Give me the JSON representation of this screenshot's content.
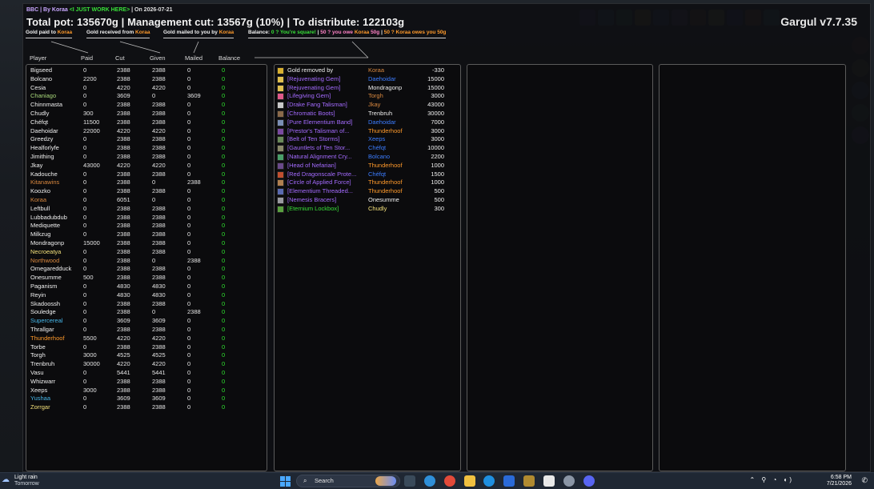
{
  "header": {
    "meta_prefix": "BBC | By Koraa ",
    "meta_note": "<I JUST WORK HERE>",
    "meta_date": " | On 2026-07-21",
    "title": "Total pot: 135670g | Management cut: 13567g (10%) | To distribute: 122103g",
    "brand": "Gargul v7.7.35"
  },
  "legend": {
    "paid_label": "Gold paid to ",
    "paid_name": "Koraa",
    "received_label": "Gold received from ",
    "received_name": "Koraa",
    "mailed_label": "Gold mailed to you by ",
    "mailed_name": "Koraa",
    "balance_label": "Balance: ",
    "balance_square": "0 ? You're square!",
    "sep1": " | ",
    "balance_owe_prefix": "50 ? you owe ",
    "balance_owe_name": "Koraa",
    "balance_owe_amount": " 50g",
    "sep2": " | ",
    "balance_owed_prefix": "50 ? ",
    "balance_owed_name": "Koraa",
    "balance_owed_suffix": " owes you 50g"
  },
  "columns": {
    "player": "Player",
    "paid": "Paid",
    "cut": "Cut",
    "given": "Given",
    "mailed": "Mailed",
    "balance": "Balance"
  },
  "players": [
    {
      "name": "Bigseed",
      "paid": "0",
      "cut": "2388",
      "given": "2388",
      "mailed": "0",
      "balance": "0",
      "color": "#f0f0f0"
    },
    {
      "name": "Bolcano",
      "paid": "2200",
      "cut": "2388",
      "given": "2388",
      "mailed": "0",
      "balance": "0",
      "color": "#f0f0f0"
    },
    {
      "name": "Cesia",
      "paid": "0",
      "cut": "4220",
      "given": "4220",
      "mailed": "0",
      "balance": "0",
      "color": "#f0f0f0"
    },
    {
      "name": "Chaniago",
      "paid": "0",
      "cut": "3609",
      "given": "0",
      "mailed": "3609",
      "balance": "0",
      "color": "#a8d87a"
    },
    {
      "name": "Chinnmasta",
      "paid": "0",
      "cut": "2388",
      "given": "2388",
      "mailed": "0",
      "balance": "0",
      "color": "#f0f0f0"
    },
    {
      "name": "Chudly",
      "paid": "300",
      "cut": "2388",
      "given": "2388",
      "mailed": "0",
      "balance": "0",
      "color": "#f0f0f0"
    },
    {
      "name": "Chéfqt",
      "paid": "11500",
      "cut": "2388",
      "given": "2388",
      "mailed": "0",
      "balance": "0",
      "color": "#f0f0f0"
    },
    {
      "name": "Daehoidar",
      "paid": "22000",
      "cut": "4220",
      "given": "4220",
      "mailed": "0",
      "balance": "0",
      "color": "#f0f0f0"
    },
    {
      "name": "Greedzy",
      "paid": "0",
      "cut": "2388",
      "given": "2388",
      "mailed": "0",
      "balance": "0",
      "color": "#f0f0f0"
    },
    {
      "name": "Healforlyfe",
      "paid": "0",
      "cut": "2388",
      "given": "2388",
      "mailed": "0",
      "balance": "0",
      "color": "#f0f0f0"
    },
    {
      "name": "Jimithing",
      "paid": "0",
      "cut": "2388",
      "given": "2388",
      "mailed": "0",
      "balance": "0",
      "color": "#f0f0f0"
    },
    {
      "name": "Jkay",
      "paid": "43000",
      "cut": "4220",
      "given": "4220",
      "mailed": "0",
      "balance": "0",
      "color": "#f0f0f0"
    },
    {
      "name": "Kadouche",
      "paid": "0",
      "cut": "2388",
      "given": "2388",
      "mailed": "0",
      "balance": "0",
      "color": "#f0f0f0"
    },
    {
      "name": "Kitanawins",
      "paid": "0",
      "cut": "2388",
      "given": "0",
      "mailed": "2388",
      "balance": "0",
      "color": "#d9883f"
    },
    {
      "name": "Koozko",
      "paid": "0",
      "cut": "2388",
      "given": "2388",
      "mailed": "0",
      "balance": "0",
      "color": "#f0f0f0"
    },
    {
      "name": "Koraa",
      "paid": "0",
      "cut": "6051",
      "given": "0",
      "mailed": "0",
      "balance": "0",
      "color": "#d9883f"
    },
    {
      "name": "Leftbull",
      "paid": "0",
      "cut": "2388",
      "given": "2388",
      "mailed": "0",
      "balance": "0",
      "color": "#f0f0f0"
    },
    {
      "name": "Lubbadubdub",
      "paid": "0",
      "cut": "2388",
      "given": "2388",
      "mailed": "0",
      "balance": "0",
      "color": "#f0f0f0"
    },
    {
      "name": "Mediquette",
      "paid": "0",
      "cut": "2388",
      "given": "2388",
      "mailed": "0",
      "balance": "0",
      "color": "#f0f0f0"
    },
    {
      "name": "Milkzug",
      "paid": "0",
      "cut": "2388",
      "given": "2388",
      "mailed": "0",
      "balance": "0",
      "color": "#f0f0f0"
    },
    {
      "name": "Mondragonp",
      "paid": "15000",
      "cut": "2388",
      "given": "2388",
      "mailed": "0",
      "balance": "0",
      "color": "#f0f0f0"
    },
    {
      "name": "Necroeatya",
      "paid": "0",
      "cut": "2388",
      "given": "2388",
      "mailed": "0",
      "balance": "0",
      "color": "#f3e07a"
    },
    {
      "name": "Northwood",
      "paid": "0",
      "cut": "2388",
      "given": "0",
      "mailed": "2388",
      "balance": "0",
      "color": "#d9883f"
    },
    {
      "name": "Omegaredduck",
      "paid": "0",
      "cut": "2388",
      "given": "2388",
      "mailed": "0",
      "balance": "0",
      "color": "#f0f0f0"
    },
    {
      "name": "Onesumme",
      "paid": "500",
      "cut": "2388",
      "given": "2388",
      "mailed": "0",
      "balance": "0",
      "color": "#f0f0f0"
    },
    {
      "name": "Paganism",
      "paid": "0",
      "cut": "4830",
      "given": "4830",
      "mailed": "0",
      "balance": "0",
      "color": "#f0f0f0"
    },
    {
      "name": "Reyin",
      "paid": "0",
      "cut": "4830",
      "given": "4830",
      "mailed": "0",
      "balance": "0",
      "color": "#f0f0f0"
    },
    {
      "name": "Skadoossh",
      "paid": "0",
      "cut": "2388",
      "given": "2388",
      "mailed": "0",
      "balance": "0",
      "color": "#f0f0f0"
    },
    {
      "name": "Souledge",
      "paid": "0",
      "cut": "2388",
      "given": "0",
      "mailed": "2388",
      "balance": "0",
      "color": "#f0f0f0"
    },
    {
      "name": "Supercereal",
      "paid": "0",
      "cut": "3609",
      "given": "3609",
      "mailed": "0",
      "balance": "0",
      "color": "#46b6e8"
    },
    {
      "name": "Thrallgar",
      "paid": "0",
      "cut": "2388",
      "given": "2388",
      "mailed": "0",
      "balance": "0",
      "color": "#f0f0f0"
    },
    {
      "name": "Thunderhoof",
      "paid": "5500",
      "cut": "4220",
      "given": "4220",
      "mailed": "0",
      "balance": "0",
      "color": "#ff9a2b"
    },
    {
      "name": "Torbe",
      "paid": "0",
      "cut": "2388",
      "given": "2388",
      "mailed": "0",
      "balance": "0",
      "color": "#f0f0f0"
    },
    {
      "name": "Torgh",
      "paid": "3000",
      "cut": "4525",
      "given": "4525",
      "mailed": "0",
      "balance": "0",
      "color": "#f0f0f0"
    },
    {
      "name": "Trenbruh",
      "paid": "30000",
      "cut": "4220",
      "given": "4220",
      "mailed": "0",
      "balance": "0",
      "color": "#f0f0f0"
    },
    {
      "name": "Vasu",
      "paid": "0",
      "cut": "5441",
      "given": "5441",
      "mailed": "0",
      "balance": "0",
      "color": "#f0f0f0"
    },
    {
      "name": "Whizwarr",
      "paid": "0",
      "cut": "2388",
      "given": "2388",
      "mailed": "0",
      "balance": "0",
      "color": "#f0f0f0"
    },
    {
      "name": "Xeeps",
      "paid": "3000",
      "cut": "2388",
      "given": "2388",
      "mailed": "0",
      "balance": "0",
      "color": "#f0f0f0"
    },
    {
      "name": "Yushaa",
      "paid": "0",
      "cut": "3609",
      "given": "3609",
      "mailed": "0",
      "balance": "0",
      "color": "#46b6e8"
    },
    {
      "name": "Zorrgar",
      "paid": "0",
      "cut": "2388",
      "given": "2388",
      "mailed": "0",
      "balance": "0",
      "color": "#f3e07a"
    }
  ],
  "loot": [
    {
      "item": "Gold removed by",
      "who": "Koraa",
      "amount": "-330",
      "item_color": "#f0f0f0",
      "who_color": "#d9883f",
      "icon_color": "#d8b030"
    },
    {
      "item": "[Rejuvenating Gem]",
      "who": "Daehoidar",
      "amount": "15000",
      "item_color": "#a46bff",
      "who_color": "#3c7dff",
      "icon_color": "#e0c050"
    },
    {
      "item": "[Rejuvenating Gem]",
      "who": "Mondragonp",
      "amount": "15000",
      "item_color": "#a46bff",
      "who_color": "#f0f0f0",
      "icon_color": "#e0c050"
    },
    {
      "item": "[Lifegiving Gem]",
      "who": "Torgh",
      "amount": "3000",
      "item_color": "#a46bff",
      "who_color": "#d9883f",
      "icon_color": "#e05a8a"
    },
    {
      "item": "[Drake Fang Talisman]",
      "who": "Jkay",
      "amount": "43000",
      "item_color": "#a46bff",
      "who_color": "#d9883f",
      "icon_color": "#c9c9c9"
    },
    {
      "item": "[Chromatic Boots]",
      "who": "Trenbruh",
      "amount": "30000",
      "item_color": "#a46bff",
      "who_color": "#f0f0f0",
      "icon_color": "#8a6a4a"
    },
    {
      "item": "[Pure Elementium Band]",
      "who": "Daehoidar",
      "amount": "7000",
      "item_color": "#a46bff",
      "who_color": "#3c7dff",
      "icon_color": "#7b8fb5"
    },
    {
      "item": "[Prestor's Talisman of...",
      "who": "Thunderhoof",
      "amount": "3000",
      "item_color": "#a46bff",
      "who_color": "#ff9a2b",
      "icon_color": "#7a4aa0"
    },
    {
      "item": "[Belt of Ten Storms]",
      "who": "Xeeps",
      "amount": "3000",
      "item_color": "#a46bff",
      "who_color": "#3c7dff",
      "icon_color": "#6a8a5a"
    },
    {
      "item": "[Gauntlets of Ten Stor...",
      "who": "Chéfqt",
      "amount": "10000",
      "item_color": "#a46bff",
      "who_color": "#3c7dff",
      "icon_color": "#8a8a6a"
    },
    {
      "item": "[Natural Alignment Cry...",
      "who": "Bolcano",
      "amount": "2200",
      "item_color": "#a46bff",
      "who_color": "#3c7dff",
      "icon_color": "#4aa06a"
    },
    {
      "item": "[Head of Nefarian]",
      "who": "Thunderhoof",
      "amount": "1000",
      "item_color": "#a46bff",
      "who_color": "#ff9a2b",
      "icon_color": "#6a4a8a"
    },
    {
      "item": "[Red Dragonscale Prote...",
      "who": "Chéfqt",
      "amount": "1500",
      "item_color": "#a46bff",
      "who_color": "#3c7dff",
      "icon_color": "#c05030"
    },
    {
      "item": "[Circle of Applied Force]",
      "who": "Thunderhoof",
      "amount": "1000",
      "item_color": "#a46bff",
      "who_color": "#ff9a2b",
      "icon_color": "#b08050"
    },
    {
      "item": "[Elementium Threaded...",
      "who": "Thunderhoof",
      "amount": "500",
      "item_color": "#a46bff",
      "who_color": "#ff9a2b",
      "icon_color": "#5a6ab0"
    },
    {
      "item": "[Nemesis Bracers]",
      "who": "Onesumme",
      "amount": "500",
      "item_color": "#a46bff",
      "who_color": "#f0f0f0",
      "icon_color": "#9a9aa0"
    },
    {
      "item": "[Eternium Lockbox]",
      "who": "Chudly",
      "amount": "300",
      "item_color": "#38e038",
      "who_color": "#f3e07a",
      "icon_color": "#5aa040"
    }
  ],
  "taskbar": {
    "weather_main": "Light rain",
    "weather_sub": "Tomorrow",
    "search_placeholder": "Search",
    "time": "6:58 PM",
    "date": "7/21/2026"
  },
  "colors": {
    "balance_green": "#2fe02f",
    "panel_border": "#5b5b5b",
    "accent_blue": "#4aa8ff"
  }
}
